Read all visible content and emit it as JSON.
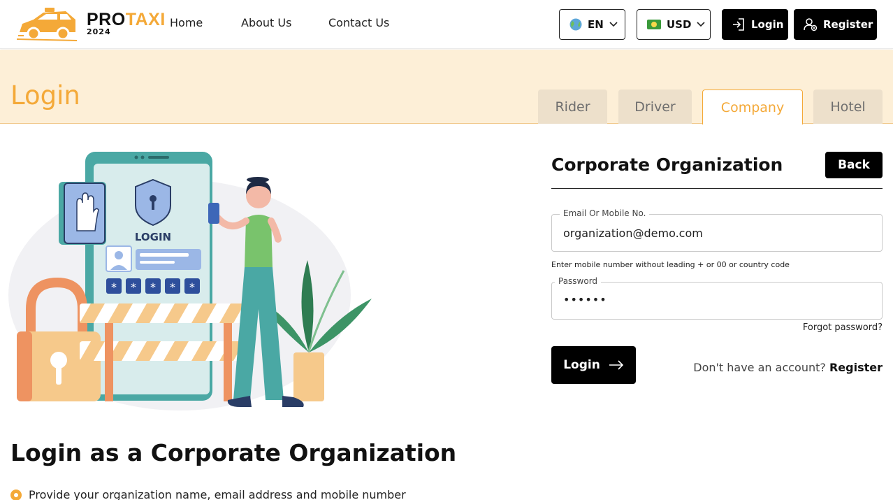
{
  "brand": {
    "name_pro": "PRO",
    "name_taxi": "TAXI",
    "year": "2024"
  },
  "nav": {
    "links": [
      "Home",
      "About Us",
      "Contact Us"
    ],
    "language": "EN",
    "currency": "USD",
    "login_label": "Login",
    "register_label": "Register"
  },
  "page": {
    "title": "Login",
    "tabs": [
      {
        "label": "Rider",
        "active": false
      },
      {
        "label": "Driver",
        "active": false
      },
      {
        "label": "Company",
        "active": true
      },
      {
        "label": "Hotel",
        "active": false
      }
    ]
  },
  "illustration": {
    "screen_label": "LOGIN"
  },
  "form": {
    "title": "Corporate Organization",
    "back_label": "Back",
    "email_label": "Email Or Mobile No.",
    "email_value": "organization@demo.com",
    "hint": "Enter mobile number without leading + or 00 or country code",
    "password_label": "Password",
    "password_value": "••••••",
    "forgot_label": "Forgot password?",
    "submit_label": "Login",
    "no_account_text": "Don't have an account?",
    "register_link": "Register"
  },
  "info": {
    "heading": "Login as a Corporate Organization",
    "bullets": [
      "Provide your organization name, email address and mobile number"
    ]
  },
  "colors": {
    "accent": "#f4a938",
    "band": "#fdefd7",
    "tab_inactive": "#ede0cb"
  }
}
